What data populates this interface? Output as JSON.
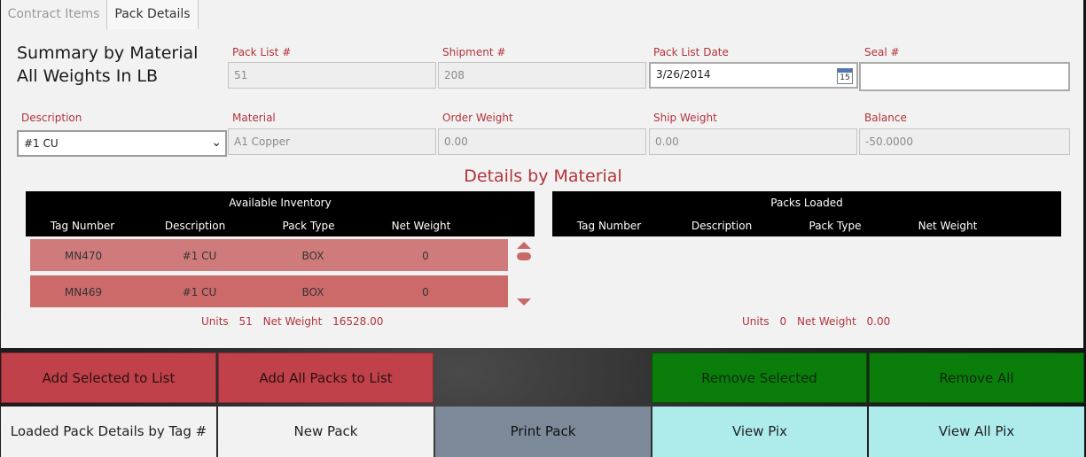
{
  "tabs": [
    {
      "label": "Contract Items",
      "active": false
    },
    {
      "label": "Pack Details",
      "active": true
    }
  ],
  "summary": {
    "line1": "Summary by Material",
    "line2": "All Weights In LB"
  },
  "fields": {
    "pack_list_label": "Pack List #",
    "pack_list_value": "51",
    "shipment_label": "Shipment #",
    "shipment_value": "208",
    "pack_list_date_label": "Pack List Date",
    "pack_list_date_value": "3/26/2014",
    "calendar_day": "15",
    "seal_label": "Seal #",
    "seal_value": "",
    "description_label": "Description",
    "description_value": "#1 CU",
    "material_label": "Material",
    "material_value": "A1 Copper",
    "order_weight_label": "Order Weight",
    "order_weight_value": "0.00",
    "ship_weight_label": "Ship Weight",
    "ship_weight_value": "0.00",
    "balance_label": "Balance",
    "balance_value": "-50.0000"
  },
  "details_title": "Details by Material",
  "available": {
    "title": "Available Inventory",
    "columns": [
      "Tag Number",
      "Description",
      "Pack Type",
      "Net Weight"
    ],
    "rows": [
      [
        "MN470",
        "#1 CU",
        "BOX",
        "0"
      ],
      [
        "MN469",
        "#1 CU",
        "BOX",
        "0"
      ]
    ],
    "totals": {
      "units_label": "Units",
      "units": "51",
      "weight_label": "Net Weight",
      "weight": "16528.00"
    }
  },
  "loaded": {
    "title": "Packs Loaded",
    "columns": [
      "Tag Number",
      "Description",
      "Pack Type",
      "Net Weight"
    ],
    "totals": {
      "units_label": "Units",
      "units": "0",
      "weight_label": "Net Weight",
      "weight": "0.00"
    }
  },
  "buttons": {
    "add_selected": "Add Selected to List",
    "add_all": "Add All Packs to List",
    "remove_selected": "Remove Selected",
    "remove_all": "Remove All",
    "loaded_details": "Loaded Pack Details by Tag #",
    "new_pack": "New Pack",
    "print_pack": "Print Pack",
    "view_pix": "View Pix",
    "view_all_pix": "View All Pix"
  },
  "colors": {
    "accent_red": "#b1343b",
    "button_red": "#c0414a",
    "button_green": "#0a7d0a",
    "button_gray": "#7b8998",
    "button_cyan": "#aeecec",
    "row_bg": "#d07b7b"
  }
}
